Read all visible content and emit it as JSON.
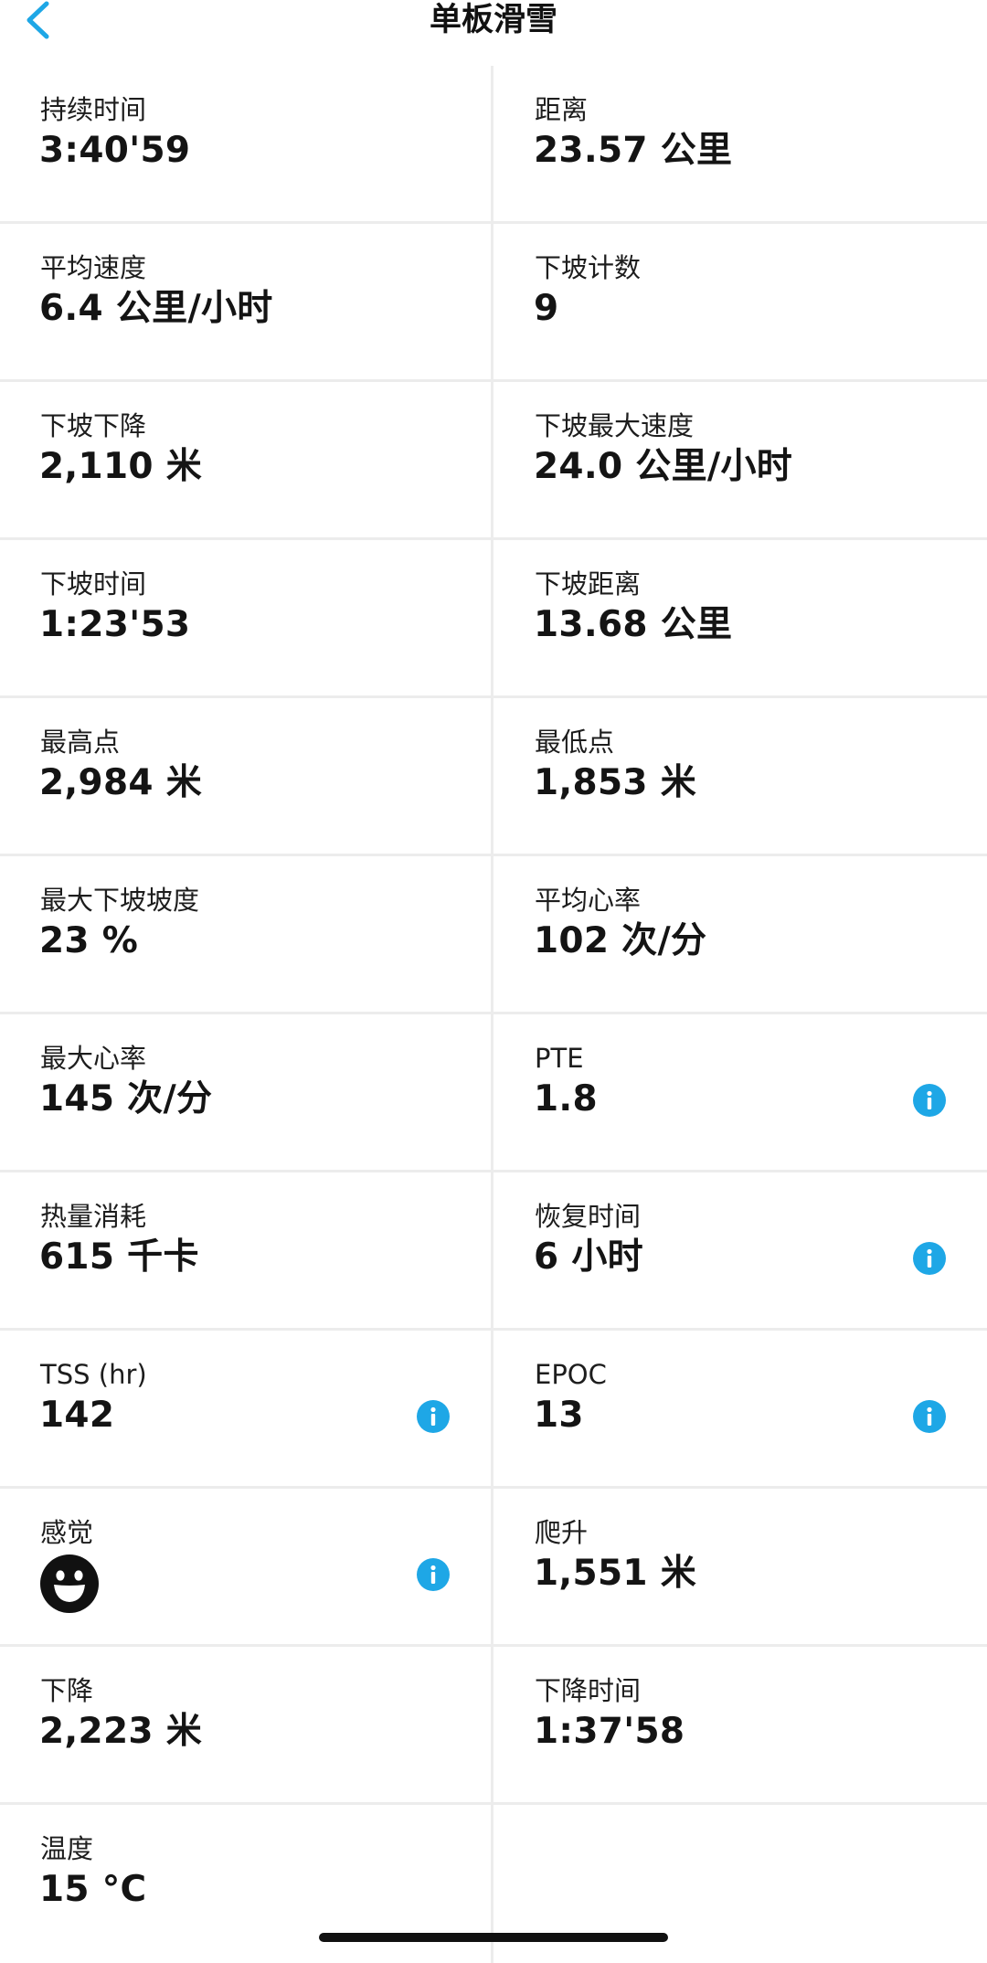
{
  "header": {
    "title": "单板滑雪"
  },
  "colors": {
    "accent": "#1ea7e6",
    "divider": "#ececec",
    "text": "#141414"
  },
  "stats": [
    {
      "label": "持续时间",
      "value": "3:40'59"
    },
    {
      "label": "距离",
      "value": "23.57 公里"
    },
    {
      "label": "平均速度",
      "value": "6.4 公里/小时"
    },
    {
      "label": "下坡计数",
      "value": "9"
    },
    {
      "label": "下坡下降",
      "value": "2,110 米"
    },
    {
      "label": "下坡最大速度",
      "value": "24.0 公里/小时"
    },
    {
      "label": "下坡时间",
      "value": "1:23'53"
    },
    {
      "label": "下坡距离",
      "value": "13.68 公里"
    },
    {
      "label": "最高点",
      "value": "2,984 米"
    },
    {
      "label": "最低点",
      "value": "1,853 米"
    },
    {
      "label": "最大下坡坡度",
      "value": "23 %"
    },
    {
      "label": "平均心率",
      "value": "102 次/分"
    },
    {
      "label": "最大心率",
      "value": "145 次/分"
    },
    {
      "label": "PTE",
      "value": "1.8",
      "icon": "info-icon"
    },
    {
      "label": "热量消耗",
      "value": "615 千卡"
    },
    {
      "label": "恢复时间",
      "value": "6 小时",
      "icon": "info-icon"
    },
    {
      "label": "TSS (hr)",
      "value": "142",
      "icon": "info-icon"
    },
    {
      "label": "EPOC",
      "value": "13",
      "icon": "info-icon"
    },
    {
      "label": "感觉",
      "value_icon": "smiley-face-icon",
      "icon": "info-icon"
    },
    {
      "label": "爬升",
      "value": "1,551 米"
    },
    {
      "label": "下降",
      "value": "2,223 米"
    },
    {
      "label": "下降时间",
      "value": "1:37'58"
    },
    {
      "label": "温度",
      "value": "15 °C"
    }
  ]
}
